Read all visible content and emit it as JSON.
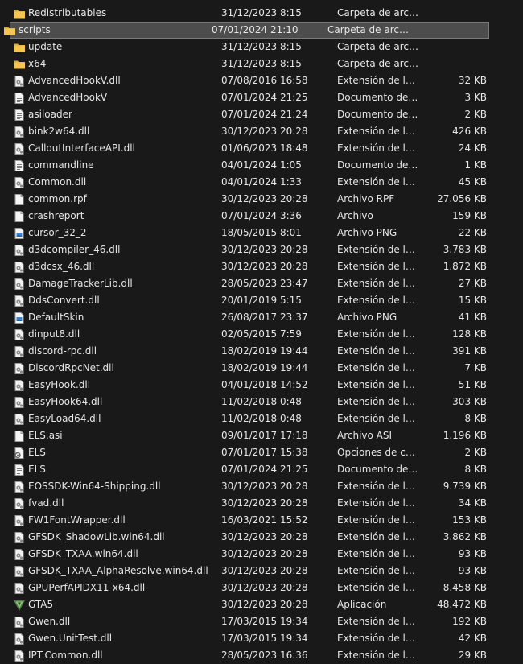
{
  "colors": {
    "background": "#191919",
    "text": "#e6e6e6",
    "selection": "#4d4d4d",
    "folder": "#f5c451"
  },
  "files": [
    {
      "name": "Redistributables",
      "date": "31/12/2023 8:15",
      "type": "Carpeta de archivos",
      "size": "",
      "icon": "folder-icon"
    },
    {
      "name": "scripts",
      "date": "07/01/2024 21:10",
      "type": "Carpeta de archivos",
      "size": "",
      "icon": "folder-icon",
      "selected": true
    },
    {
      "name": "update",
      "date": "31/12/2023 8:15",
      "type": "Carpeta de archivos",
      "size": "",
      "icon": "folder-icon"
    },
    {
      "name": "x64",
      "date": "31/12/2023 8:15",
      "type": "Carpeta de archivos",
      "size": "",
      "icon": "folder-icon"
    },
    {
      "name": "AdvancedHookV.dll",
      "date": "07/08/2016 16:58",
      "type": "Extensión de la ap...",
      "size": "32 KB",
      "icon": "dll-file-icon"
    },
    {
      "name": "AdvancedHookV",
      "date": "07/01/2024 21:25",
      "type": "Documento de te...",
      "size": "3 KB",
      "icon": "text-file-icon"
    },
    {
      "name": "asiloader",
      "date": "07/01/2024 21:24",
      "type": "Documento de te...",
      "size": "2 KB",
      "icon": "text-file-icon"
    },
    {
      "name": "bink2w64.dll",
      "date": "30/12/2023 20:28",
      "type": "Extensión de la ap...",
      "size": "426 KB",
      "icon": "dll-file-icon"
    },
    {
      "name": "CalloutInterfaceAPI.dll",
      "date": "01/06/2023 18:48",
      "type": "Extensión de la ap...",
      "size": "24 KB",
      "icon": "dll-file-icon"
    },
    {
      "name": "commandline",
      "date": "04/01/2024 1:05",
      "type": "Documento de te...",
      "size": "1 KB",
      "icon": "text-file-icon"
    },
    {
      "name": "Common.dll",
      "date": "04/01/2024 1:33",
      "type": "Extensión de la ap...",
      "size": "45 KB",
      "icon": "dll-file-icon"
    },
    {
      "name": "common.rpf",
      "date": "30/12/2023 20:28",
      "type": "Archivo RPF",
      "size": "27.056 KB",
      "icon": "blank-file-icon"
    },
    {
      "name": "crashreport",
      "date": "07/01/2024 3:36",
      "type": "Archivo",
      "size": "159 KB",
      "icon": "blank-file-icon"
    },
    {
      "name": "cursor_32_2",
      "date": "18/05/2015 8:01",
      "type": "Archivo PNG",
      "size": "22 KB",
      "icon": "image-file-icon"
    },
    {
      "name": "d3dcompiler_46.dll",
      "date": "30/12/2023 20:28",
      "type": "Extensión de la ap...",
      "size": "3.783 KB",
      "icon": "dll-file-icon"
    },
    {
      "name": "d3dcsx_46.dll",
      "date": "30/12/2023 20:28",
      "type": "Extensión de la ap...",
      "size": "1.872 KB",
      "icon": "dll-file-icon"
    },
    {
      "name": "DamageTrackerLib.dll",
      "date": "28/05/2023 23:47",
      "type": "Extensión de la ap...",
      "size": "27 KB",
      "icon": "dll-file-icon"
    },
    {
      "name": "DdsConvert.dll",
      "date": "20/01/2019 5:15",
      "type": "Extensión de la ap...",
      "size": "15 KB",
      "icon": "dll-file-icon"
    },
    {
      "name": "DefaultSkin",
      "date": "26/08/2017 23:37",
      "type": "Archivo PNG",
      "size": "41 KB",
      "icon": "image-file-icon"
    },
    {
      "name": "dinput8.dll",
      "date": "02/05/2015 7:59",
      "type": "Extensión de la ap...",
      "size": "128 KB",
      "icon": "dll-file-icon"
    },
    {
      "name": "discord-rpc.dll",
      "date": "18/02/2019 19:44",
      "type": "Extensión de la ap...",
      "size": "391 KB",
      "icon": "dll-file-icon"
    },
    {
      "name": "DiscordRpcNet.dll",
      "date": "18/02/2019 19:44",
      "type": "Extensión de la ap...",
      "size": "7 KB",
      "icon": "dll-file-icon"
    },
    {
      "name": "EasyHook.dll",
      "date": "04/01/2018 14:52",
      "type": "Extensión de la ap...",
      "size": "51 KB",
      "icon": "dll-file-icon"
    },
    {
      "name": "EasyHook64.dll",
      "date": "11/02/2018 0:48",
      "type": "Extensión de la ap...",
      "size": "303 KB",
      "icon": "dll-file-icon"
    },
    {
      "name": "EasyLoad64.dll",
      "date": "11/02/2018 0:48",
      "type": "Extensión de la ap...",
      "size": "8 KB",
      "icon": "dll-file-icon"
    },
    {
      "name": "ELS.asi",
      "date": "09/01/2017 17:18",
      "type": "Archivo ASI",
      "size": "1.196 KB",
      "icon": "blank-file-icon"
    },
    {
      "name": "ELS",
      "date": "07/01/2017 15:38",
      "type": "Opciones de confi...",
      "size": "2 KB",
      "icon": "config-file-icon"
    },
    {
      "name": "ELS",
      "date": "07/01/2024 21:25",
      "type": "Documento de te...",
      "size": "8 KB",
      "icon": "text-file-icon"
    },
    {
      "name": "EOSSDK-Win64-Shipping.dll",
      "date": "30/12/2023 20:28",
      "type": "Extensión de la ap...",
      "size": "9.739 KB",
      "icon": "dll-file-icon"
    },
    {
      "name": "fvad.dll",
      "date": "30/12/2023 20:28",
      "type": "Extensión de la ap...",
      "size": "34 KB",
      "icon": "dll-file-icon"
    },
    {
      "name": "FW1FontWrapper.dll",
      "date": "16/03/2021 15:52",
      "type": "Extensión de la ap...",
      "size": "153 KB",
      "icon": "dll-file-icon"
    },
    {
      "name": "GFSDK_ShadowLib.win64.dll",
      "date": "30/12/2023 20:28",
      "type": "Extensión de la ap...",
      "size": "3.862 KB",
      "icon": "dll-file-icon"
    },
    {
      "name": "GFSDK_TXAA.win64.dll",
      "date": "30/12/2023 20:28",
      "type": "Extensión de la ap...",
      "size": "93 KB",
      "icon": "dll-file-icon"
    },
    {
      "name": "GFSDK_TXAA_AlphaResolve.win64.dll",
      "date": "30/12/2023 20:28",
      "type": "Extensión de la ap...",
      "size": "93 KB",
      "icon": "dll-file-icon"
    },
    {
      "name": "GPUPerfAPIDX11-x64.dll",
      "date": "30/12/2023 20:28",
      "type": "Extensión de la ap...",
      "size": "8.458 KB",
      "icon": "dll-file-icon"
    },
    {
      "name": "GTA5",
      "date": "30/12/2023 20:28",
      "type": "Aplicación",
      "size": "48.472 KB",
      "icon": "gta5-app-icon"
    },
    {
      "name": "Gwen.dll",
      "date": "17/03/2015 19:34",
      "type": "Extensión de la ap...",
      "size": "192 KB",
      "icon": "dll-file-icon"
    },
    {
      "name": "Gwen.UnitTest.dll",
      "date": "17/03/2015 19:34",
      "type": "Extensión de la ap...",
      "size": "42 KB",
      "icon": "dll-file-icon"
    },
    {
      "name": "IPT.Common.dll",
      "date": "28/05/2023 16:36",
      "type": "Extensión de la ap...",
      "size": "29 KB",
      "icon": "dll-file-icon"
    }
  ]
}
